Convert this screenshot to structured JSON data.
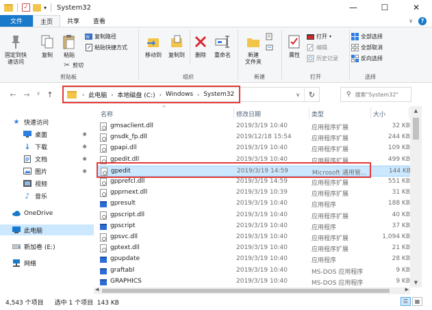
{
  "window": {
    "title": "System32",
    "minimize": "—",
    "maximize": "☐",
    "close": "✕"
  },
  "ribbon_tabs": {
    "file": "文件",
    "home": "主页",
    "share": "共享",
    "view": "查看",
    "collapse": "∨",
    "help": "?"
  },
  "ribbon": {
    "clipboard": {
      "label": "剪贴板",
      "pin": "固定到快\n速访问",
      "copy": "复制",
      "paste": "粘贴",
      "copy_path": "复制路径",
      "paste_shortcut": "粘贴快捷方式",
      "cut": "剪切"
    },
    "organize": {
      "label": "组织",
      "move_to": "移动到",
      "copy_to": "复制到",
      "delete": "删除",
      "rename": "重命名"
    },
    "new": {
      "label": "新建",
      "new_folder": "新建\n文件夹"
    },
    "open": {
      "label": "打开",
      "properties": "属性",
      "open": "打开",
      "edit": "编辑",
      "history": "历史记录"
    },
    "select": {
      "label": "选择",
      "select_all": "全部选择",
      "select_none": "全部取消",
      "invert": "反向选择"
    }
  },
  "nav": {
    "back": "←",
    "forward": "→",
    "recent": "∨",
    "up": "↑",
    "breadcrumbs": [
      "此电脑",
      "本地磁盘 (C:)",
      "Windows",
      "System32"
    ],
    "crumb_sep": "›",
    "dropdown": "∨",
    "refresh": "↻",
    "search_placeholder": "搜索\"System32\"",
    "search_icon": "⚲"
  },
  "navpane": {
    "quick_access": "快速访问",
    "desktop": "桌面",
    "downloads": "下载",
    "documents": "文档",
    "pictures": "图片",
    "videos": "视频",
    "music": "音乐",
    "onedrive": "OneDrive",
    "this_pc": "此电脑",
    "new_volume": "新加卷 (E:)",
    "network": "网络",
    "pin": "✱"
  },
  "columns": {
    "name": "名称",
    "date": "修改日期",
    "type": "类型",
    "size": "大小",
    "sort_arrow": "^"
  },
  "files": [
    {
      "name": "gmsaclient.dll",
      "date": "2019/3/19 10:40",
      "type": "应用程序扩展",
      "size": "32 KB",
      "icon": "dll"
    },
    {
      "name": "gnsdk_fp.dll",
      "date": "2019/12/18 15:54",
      "type": "应用程序扩展",
      "size": "244 KB",
      "icon": "dll"
    },
    {
      "name": "gpapi.dll",
      "date": "2019/3/19 10:40",
      "type": "应用程序扩展",
      "size": "109 KB",
      "icon": "dll"
    },
    {
      "name": "gpedit.dll",
      "date": "2019/3/19 10:40",
      "type": "应用程序扩展",
      "size": "499 KB",
      "icon": "dll"
    },
    {
      "name": "gpedit",
      "date": "2019/3/19 14:59",
      "type": "Microsoft 通用管...",
      "size": "144 KB",
      "icon": "msc",
      "selected": true
    },
    {
      "name": "gpprefcl.dll",
      "date": "2019/3/19 14:59",
      "type": "应用程序扩展",
      "size": "551 KB",
      "icon": "dll"
    },
    {
      "name": "gpprnext.dll",
      "date": "2019/3/19 10:39",
      "type": "应用程序扩展",
      "size": "31 KB",
      "icon": "dll"
    },
    {
      "name": "gpresult",
      "date": "2019/3/19 10:40",
      "type": "应用程序",
      "size": "188 KB",
      "icon": "exe"
    },
    {
      "name": "gpscript.dll",
      "date": "2019/3/19 10:40",
      "type": "应用程序扩展",
      "size": "40 KB",
      "icon": "dll"
    },
    {
      "name": "gpscript",
      "date": "2019/3/19 10:40",
      "type": "应用程序",
      "size": "37 KB",
      "icon": "exe"
    },
    {
      "name": "gpsvc.dll",
      "date": "2019/3/19 10:40",
      "type": "应用程序扩展",
      "size": "1,094 KB",
      "icon": "dll"
    },
    {
      "name": "gptext.dll",
      "date": "2019/3/19 10:40",
      "type": "应用程序扩展",
      "size": "21 KB",
      "icon": "dll"
    },
    {
      "name": "gpupdate",
      "date": "2019/3/19 10:40",
      "type": "应用程序",
      "size": "28 KB",
      "icon": "exe"
    },
    {
      "name": "graftabl",
      "date": "2019/3/19 10:40",
      "type": "MS-DOS 应用程序",
      "size": "9 KB",
      "icon": "exe"
    },
    {
      "name": "GRAPHICS",
      "date": "2019/3/19 10:40",
      "type": "MS-DOS 应用程序",
      "size": "9 KB",
      "icon": "exe"
    }
  ],
  "status": {
    "item_count": "4,543 个项目",
    "selected": "选中 1 个项目  143 KB"
  },
  "colors": {
    "accent": "#1979ca",
    "selection": "#cce8ff",
    "highlight_box": "#e53935"
  }
}
